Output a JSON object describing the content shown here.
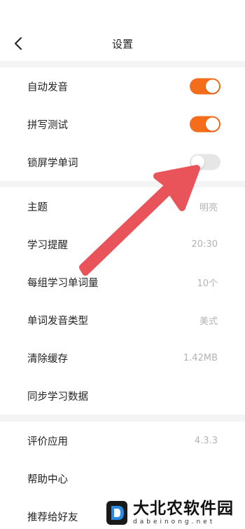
{
  "header": {
    "title": "设置"
  },
  "section1": {
    "rows": [
      {
        "label": "自动发音",
        "toggle": true
      },
      {
        "label": "拼写测试",
        "toggle": true
      },
      {
        "label": "锁屏学单词",
        "toggle": false
      }
    ]
  },
  "section2": {
    "rows": [
      {
        "label": "主题",
        "value": "明亮"
      },
      {
        "label": "学习提醒",
        "value": "20:30"
      },
      {
        "label": "每组学习单词量",
        "value": "10个"
      },
      {
        "label": "单词发音类型",
        "value": "美式"
      },
      {
        "label": "清除缓存",
        "value": "1.42MB"
      },
      {
        "label": "同步学习数据",
        "value": ""
      }
    ]
  },
  "section3": {
    "rows": [
      {
        "label": "评价应用",
        "value": "4.3.3"
      },
      {
        "label": "帮助中心",
        "value": ""
      },
      {
        "label": "推荐给好友",
        "value": ""
      }
    ]
  },
  "watermark": {
    "cn": "大北农软件园",
    "en": "dabeinong.net",
    "logo_letter": "D"
  },
  "colors": {
    "accent": "#f36d1b",
    "toggle_off": "#e6e6e6",
    "arrow": "#e8545a",
    "section_gap": "#f4f4f4"
  },
  "icons": {
    "back": "chevron-left-icon",
    "annotation": "red-arrow-annotation"
  }
}
